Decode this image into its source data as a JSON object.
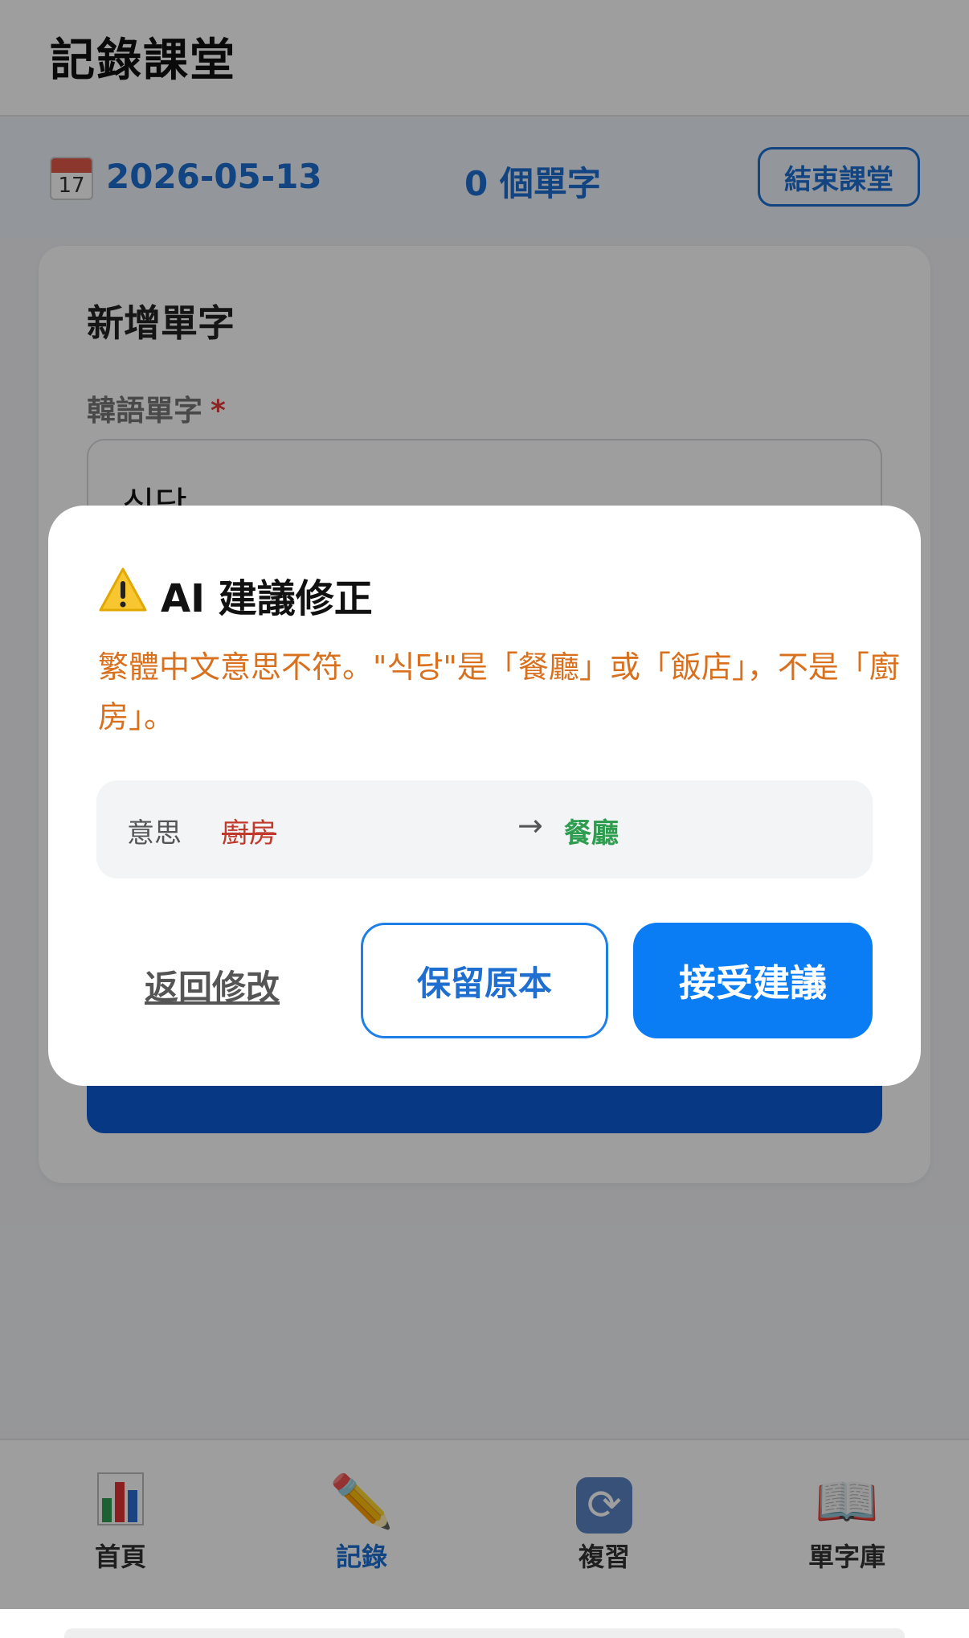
{
  "header": {
    "title": "記錄課堂"
  },
  "session": {
    "calendar_day": "17",
    "date": "2026-05-13",
    "word_count": "0 個單字",
    "end_button": "結束課堂"
  },
  "card": {
    "title": "新增單字",
    "korean_label": "韓語單字",
    "required_mark": "*",
    "korean_value": "식당"
  },
  "dialog": {
    "icon": "warning-icon",
    "title": "AI 建議修正",
    "message": "繁體中文意思不符。\"식당\"是「餐廳」或「飯店」，不是「廚房」。",
    "comparison": {
      "field": "意思",
      "original": "廚房",
      "arrow": "→",
      "suggested": "餐廳"
    },
    "back_button": "返回修改",
    "keep_button": "保留原本",
    "accept_button": "接受建議"
  },
  "tabbar": {
    "items": [
      {
        "label": "首頁",
        "icon": "chart-icon"
      },
      {
        "label": "記錄",
        "icon": "pencil-icon"
      },
      {
        "label": "複習",
        "icon": "refresh-icon"
      },
      {
        "label": "單字庫",
        "icon": "book-icon"
      }
    ],
    "active_index": 1
  },
  "colors": {
    "accent": "#1e6fd0",
    "primary_button": "#0a7df5",
    "warning_text": "#d9701e",
    "removed": "#c0392b",
    "added": "#2e9d4f"
  }
}
